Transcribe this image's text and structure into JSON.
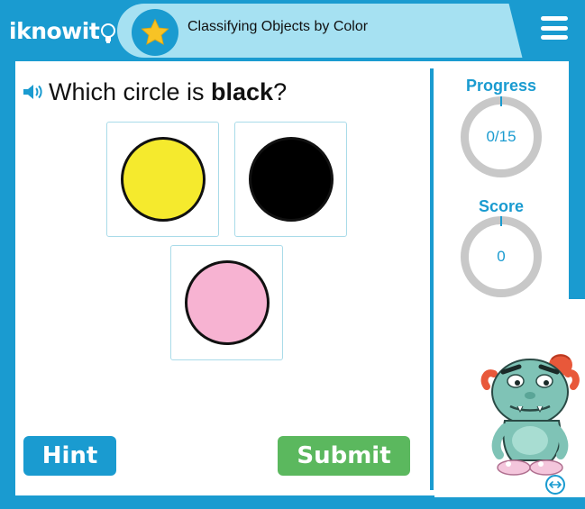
{
  "header": {
    "logo_text": "iknowit",
    "title": "Classifying Objects by Color",
    "star_icon": "star-icon",
    "menu_icon": "hamburger-menu-icon"
  },
  "question": {
    "prefix": "Which circle is ",
    "keyword": "black",
    "suffix": "?",
    "audio_icon": "speaker-icon"
  },
  "choices": [
    {
      "color_name": "yellow",
      "fill": "#f5ea2d"
    },
    {
      "color_name": "black",
      "fill": "#000000"
    },
    {
      "color_name": "pink",
      "fill": "#f7b3d2"
    }
  ],
  "buttons": {
    "hint_label": "Hint",
    "submit_label": "Submit"
  },
  "progress": {
    "label": "Progress",
    "value": "0/15",
    "current": 0,
    "total": 15
  },
  "score": {
    "label": "Score",
    "value": "0"
  },
  "colors": {
    "brand_blue": "#1a9bd0",
    "title_band": "#a6e1f2",
    "submit_green": "#5bb85e",
    "ring_gray": "#c8c8c8"
  }
}
